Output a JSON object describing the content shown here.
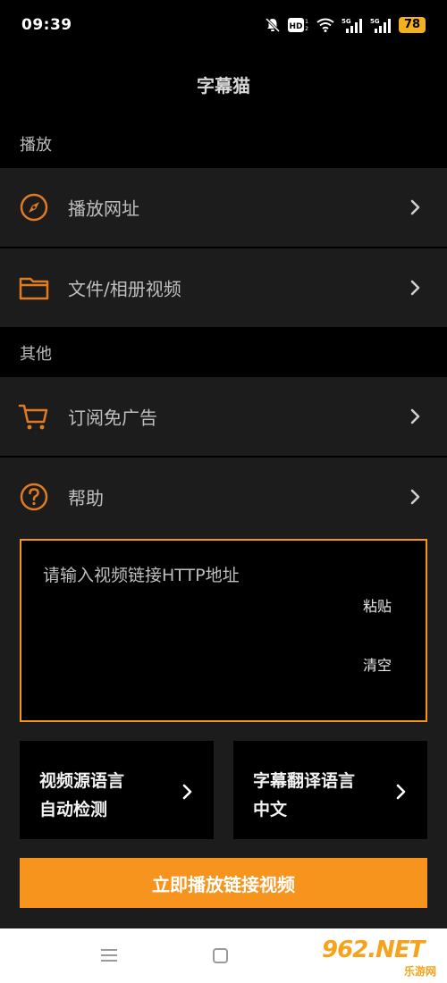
{
  "status_bar": {
    "time": "09:39",
    "battery": "78",
    "icons": [
      "bell-muted-icon",
      "hd-icon",
      "wifi-icon",
      "5g-signal-icon",
      "5g-signal-icon",
      "battery-icon"
    ]
  },
  "header": {
    "title": "字幕猫"
  },
  "sections": {
    "play": {
      "label": "播放",
      "items": [
        {
          "label": "播放网址",
          "icon": "compass-icon"
        },
        {
          "label": "文件/相册视频",
          "icon": "folder-icon"
        }
      ]
    },
    "other": {
      "label": "其他",
      "items": [
        {
          "label": "订阅免广告",
          "icon": "cart-icon"
        },
        {
          "label": "帮助",
          "icon": "help-icon"
        }
      ]
    }
  },
  "url_input": {
    "placeholder": "请输入视频链接HTTP地址",
    "paste_label": "粘贴",
    "clear_label": "清空"
  },
  "language": {
    "source": {
      "title": "视频源语言",
      "value": "自动检测"
    },
    "target": {
      "title": "字幕翻译语言",
      "value": "中文"
    }
  },
  "play_button": {
    "label": "立即播放链接视频"
  },
  "watermark": {
    "brand": "962.NET",
    "sub": "乐游网"
  },
  "colors": {
    "accent": "#f7941d",
    "background": "#000000",
    "panel": "#1c1c1c",
    "battery": "#f3b21d"
  }
}
